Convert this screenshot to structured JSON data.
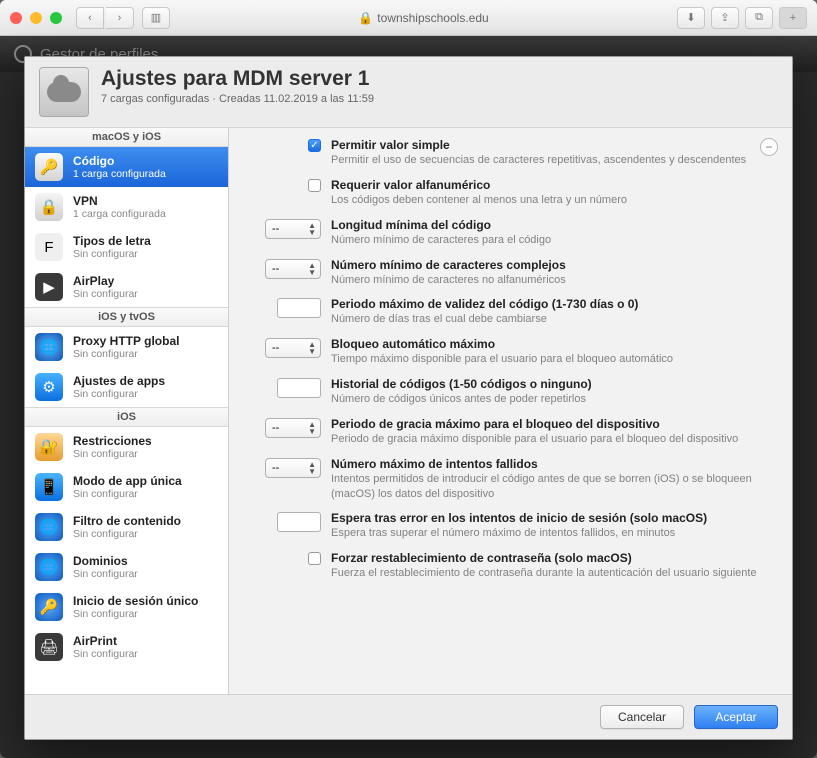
{
  "browser": {
    "url": "townshipschools.edu"
  },
  "bg": {
    "title": "Gestor de perfiles"
  },
  "header": {
    "title": "Ajustes para MDM server 1",
    "subtitle": "7 cargas configuradas · Creadas 11.02.2019 a las 11:59"
  },
  "sidebar": {
    "sections": [
      {
        "title": "macOS y iOS",
        "items": [
          {
            "name": "Código",
            "sub": "1 carga configurada",
            "icon": "ic-key",
            "glyph": "🔑",
            "selected": true
          },
          {
            "name": "VPN",
            "sub": "1 carga configurada",
            "icon": "ic-vpn",
            "glyph": "🔒"
          },
          {
            "name": "Tipos de letra",
            "sub": "Sin configurar",
            "icon": "ic-font",
            "glyph": "F"
          },
          {
            "name": "AirPlay",
            "sub": "Sin configurar",
            "icon": "ic-airplay",
            "glyph": "▶"
          }
        ]
      },
      {
        "title": "iOS y tvOS",
        "items": [
          {
            "name": "Proxy HTTP global",
            "sub": "Sin configurar",
            "icon": "ic-proxy",
            "glyph": "🌐"
          },
          {
            "name": "Ajustes de apps",
            "sub": "Sin configurar",
            "icon": "ic-apps",
            "glyph": "⚙"
          }
        ]
      },
      {
        "title": "iOS",
        "items": [
          {
            "name": "Restricciones",
            "sub": "Sin configurar",
            "icon": "ic-restr",
            "glyph": "🔐"
          },
          {
            "name": "Modo de app única",
            "sub": "Sin configurar",
            "icon": "ic-single",
            "glyph": "📱"
          },
          {
            "name": "Filtro de contenido",
            "sub": "Sin configurar",
            "icon": "ic-filter",
            "glyph": "🌐"
          },
          {
            "name": "Dominios",
            "sub": "Sin configurar",
            "icon": "ic-domain",
            "glyph": "🌐"
          },
          {
            "name": "Inicio de sesión único",
            "sub": "Sin configurar",
            "icon": "ic-sso",
            "glyph": "🔑"
          },
          {
            "name": "AirPrint",
            "sub": "Sin configurar",
            "icon": "ic-print",
            "glyph": "🖨"
          }
        ]
      }
    ]
  },
  "fields": [
    {
      "ctrl": "check",
      "checked": true,
      "label": "Permitir valor simple",
      "desc": "Permitir el uso de secuencias de caracteres repetitivas, ascendentes y descendentes"
    },
    {
      "ctrl": "check",
      "checked": false,
      "label": "Requerir valor alfanumérico",
      "desc": "Los códigos deben contener al menos una letra y un número"
    },
    {
      "ctrl": "select",
      "value": "--",
      "label": "Longitud mínima del código",
      "desc": "Número mínimo de caracteres para el código"
    },
    {
      "ctrl": "select",
      "value": "--",
      "label": "Número mínimo de caracteres complejos",
      "desc": "Número mínimo de caracteres no alfanuméricos"
    },
    {
      "ctrl": "text",
      "label": "Periodo máximo de validez del código (1-730 días o 0)",
      "desc": "Número de días tras el cual debe cambiarse"
    },
    {
      "ctrl": "select",
      "value": "--",
      "label": "Bloqueo automático máximo",
      "desc": "Tiempo máximo disponible para el usuario para el bloqueo automático"
    },
    {
      "ctrl": "text",
      "label": "Historial de códigos (1-50 códigos o ninguno)",
      "desc": "Número de códigos únicos antes de poder repetirlos"
    },
    {
      "ctrl": "select",
      "value": "--",
      "label": "Periodo de gracia máximo para el bloqueo del dispositivo",
      "desc": "Periodo de gracia máximo disponible para el usuario para el bloqueo del dispositivo"
    },
    {
      "ctrl": "select",
      "value": "--",
      "label": "Número máximo de intentos fallidos",
      "desc": "Intentos permitidos de introducir el código antes de que se borren (iOS) o se bloqueen (macOS) los datos del dispositivo"
    },
    {
      "ctrl": "text",
      "label": "Espera tras error en los intentos de inicio de sesión (solo macOS)",
      "desc": "Espera tras superar el número máximo de intentos fallidos, en minutos"
    },
    {
      "ctrl": "check",
      "checked": false,
      "label": "Forzar restablecimiento de contraseña (solo macOS)",
      "desc": "Fuerza el restablecimiento de contraseña durante la autenticación del usuario siguiente"
    }
  ],
  "footer": {
    "cancel": "Cancelar",
    "ok": "Aceptar"
  }
}
